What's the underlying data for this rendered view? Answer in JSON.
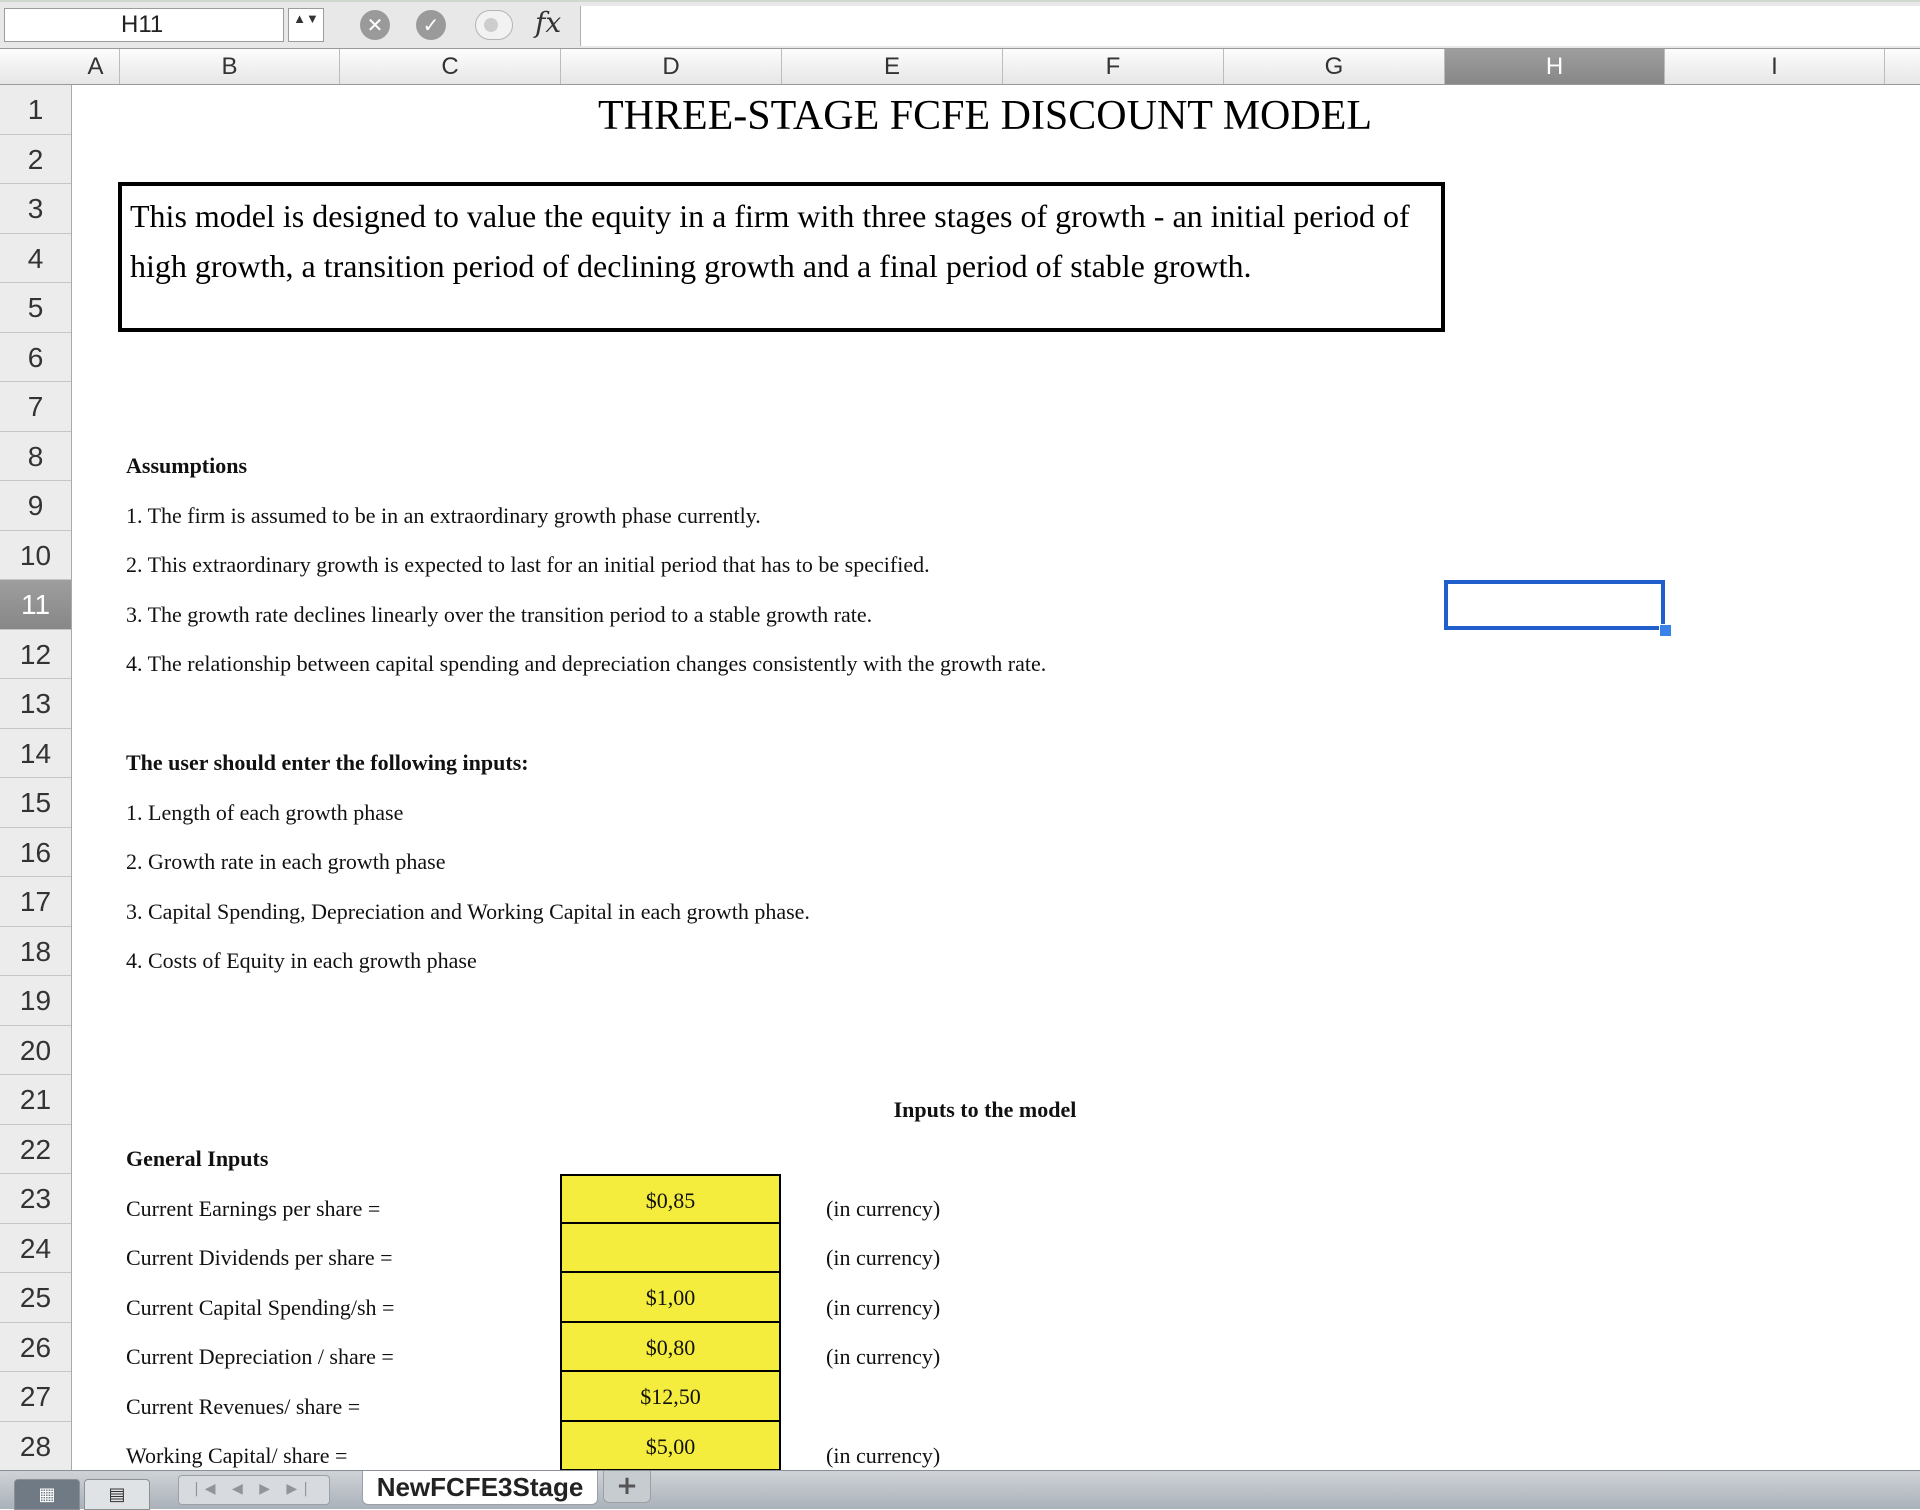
{
  "formula_bar": {
    "name_box": "H11",
    "stepper_glyph": "▲▼",
    "cancel_glyph": "✕",
    "confirm_glyph": "✓",
    "fx_label": "fx",
    "formula_value": ""
  },
  "columns": [
    "A",
    "B",
    "C",
    "D",
    "E",
    "F",
    "G",
    "H",
    "I"
  ],
  "selected_column": "H",
  "rows": [
    "1",
    "2",
    "3",
    "4",
    "5",
    "6",
    "7",
    "8",
    "9",
    "10",
    "11",
    "12",
    "13",
    "14",
    "15",
    "16",
    "17",
    "18",
    "19",
    "20",
    "21",
    "22",
    "23",
    "24",
    "25",
    "26",
    "27",
    "28"
  ],
  "selected_row": "11",
  "sheet": {
    "title": "THREE-STAGE FCFE DISCOUNT MODEL",
    "description": "This model is designed to value the equity in a firm with three stages of growth - an initial period of high growth, a transition period of declining growth and a final period of stable growth.",
    "assumptions_heading": "Assumptions",
    "assumptions": [
      "1. The firm is assumed to be in an extraordinary growth phase currently.",
      "2. This extraordinary growth is expected to last for an initial period that has to be specified.",
      "3. The growth rate declines linearly over the transition period to a stable growth rate.",
      "4. The relationship between capital spending and depreciation changes consistently with the growth rate."
    ],
    "inputs_heading": "The user should enter the following inputs:",
    "inputs": [
      "1. Length of each growth phase",
      "2. Growth rate in each growth phase",
      "3. Capital Spending, Depreciation and Working Capital in each growth phase.",
      "4. Costs of Equity in each growth phase"
    ],
    "model_inputs_heading": "Inputs to the model",
    "general_inputs_heading": "General Inputs",
    "general_inputs": [
      {
        "label": "Current Earnings per share =",
        "value": "$0,85",
        "unit": "(in currency)"
      },
      {
        "label": "Current Dividends per share =",
        "value": "",
        "unit": "(in currency)"
      },
      {
        "label": "Current Capital Spending/sh =",
        "value": "$1,00",
        "unit": "(in currency)"
      },
      {
        "label": "Current Depreciation / share =",
        "value": "$0,80",
        "unit": "(in currency)"
      },
      {
        "label": "Current Revenues/ share =",
        "value": "$12,50",
        "unit": ""
      },
      {
        "label": "Working Capital/ share =",
        "value": "$5,00",
        "unit": "(in currency)"
      }
    ]
  },
  "tab_bar": {
    "normal_view_glyph": "▦",
    "page_layout_glyph": "▤",
    "nav_glyphs": "|◀ ◀ ▶ ▶|",
    "sheet_tab": "NewFCFE3Stage",
    "add_sheet_glyph": "+"
  }
}
